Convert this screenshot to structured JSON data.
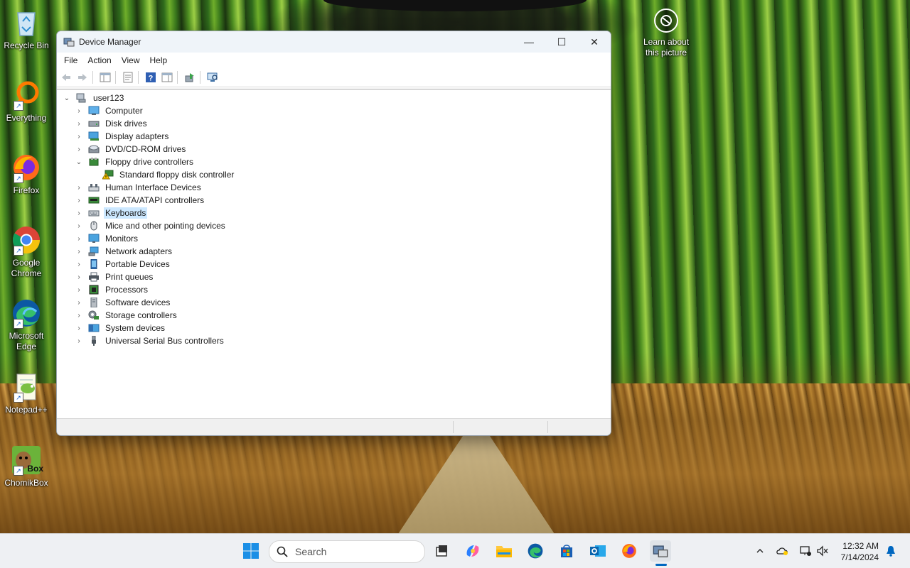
{
  "desktop": {
    "icons": [
      {
        "label": "Recycle Bin",
        "icon": "recycle-bin-icon"
      },
      {
        "label": "Everything",
        "icon": "everything-icon"
      },
      {
        "label": "Firefox",
        "icon": "firefox-icon"
      },
      {
        "label": "Google Chrome",
        "icon": "chrome-icon"
      },
      {
        "label": "Microsoft Edge",
        "icon": "edge-icon"
      },
      {
        "label": "Notepad++",
        "icon": "notepadpp-icon"
      },
      {
        "label": "ChomikBox",
        "icon": "chomikbox-icon"
      }
    ],
    "learn_label": "Learn about this picture",
    "chomik_text": "Box"
  },
  "window": {
    "title": "Device Manager",
    "controls": {
      "minimize": "—",
      "maximize": "☐",
      "close": "✕"
    },
    "menu": [
      "File",
      "Action",
      "View",
      "Help"
    ],
    "tree": {
      "root": {
        "label": "user123",
        "expanded": true
      },
      "nodes": [
        {
          "label": "Computer",
          "expanded": false,
          "icon": "computer-icon"
        },
        {
          "label": "Disk drives",
          "expanded": false,
          "icon": "disk-drive-icon"
        },
        {
          "label": "Display adapters",
          "expanded": false,
          "icon": "display-adapter-icon"
        },
        {
          "label": "DVD/CD-ROM drives",
          "expanded": false,
          "icon": "dvd-drive-icon"
        },
        {
          "label": "Floppy drive controllers",
          "expanded": true,
          "icon": "floppy-controller-icon",
          "children": [
            {
              "label": "Standard floppy disk controller",
              "icon": "warning-device-icon"
            }
          ]
        },
        {
          "label": "Human Interface Devices",
          "expanded": false,
          "icon": "hid-icon"
        },
        {
          "label": "IDE ATA/ATAPI controllers",
          "expanded": false,
          "icon": "ide-controller-icon"
        },
        {
          "label": "Keyboards",
          "expanded": false,
          "icon": "keyboard-icon",
          "selected": true
        },
        {
          "label": "Mice and other pointing devices",
          "expanded": false,
          "icon": "mouse-icon"
        },
        {
          "label": "Monitors",
          "expanded": false,
          "icon": "monitor-icon"
        },
        {
          "label": "Network adapters",
          "expanded": false,
          "icon": "network-adapter-icon"
        },
        {
          "label": "Portable Devices",
          "expanded": false,
          "icon": "portable-device-icon"
        },
        {
          "label": "Print queues",
          "expanded": false,
          "icon": "printer-icon"
        },
        {
          "label": "Processors",
          "expanded": false,
          "icon": "processor-icon"
        },
        {
          "label": "Software devices",
          "expanded": false,
          "icon": "software-device-icon"
        },
        {
          "label": "Storage controllers",
          "expanded": false,
          "icon": "storage-controller-icon"
        },
        {
          "label": "System devices",
          "expanded": false,
          "icon": "system-device-icon"
        },
        {
          "label": "Universal Serial Bus controllers",
          "expanded": false,
          "icon": "usb-icon"
        }
      ]
    }
  },
  "taskbar": {
    "search_placeholder": "Search",
    "apps": [
      "start-icon",
      "task-view-icon",
      "copilot-icon",
      "file-explorer-icon",
      "edge-icon",
      "store-icon",
      "outlook-icon",
      "firefox-icon",
      "device-manager-icon"
    ],
    "clock": {
      "time": "12:32 AM",
      "date": "7/14/2024"
    }
  },
  "colors": {
    "accent": "#0067c0",
    "selection": "#cce8ff"
  }
}
